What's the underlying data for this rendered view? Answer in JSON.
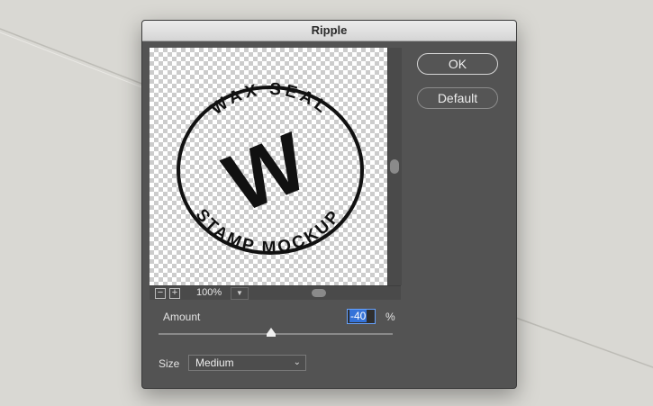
{
  "dialog": {
    "title": "Ripple",
    "ok_label": "OK",
    "default_label": "Default"
  },
  "preview": {
    "zoom_out_icon": "−",
    "zoom_in_icon": "+",
    "zoom_level": "100%",
    "zoom_dropdown_icon": "chevron-down-icon",
    "stamp_letter": "W",
    "stamp_top_text": "WAX SEAL",
    "stamp_bottom_text": "STAMP MOCKUP"
  },
  "amount": {
    "label": "Amount",
    "value": "-40",
    "unit": "%",
    "min": -999,
    "max": 999,
    "slider_value": -40
  },
  "size": {
    "label": "Size",
    "selected": "Medium"
  },
  "colors": {
    "dialog_bg": "#535353",
    "input_highlight": "#3472d8"
  }
}
